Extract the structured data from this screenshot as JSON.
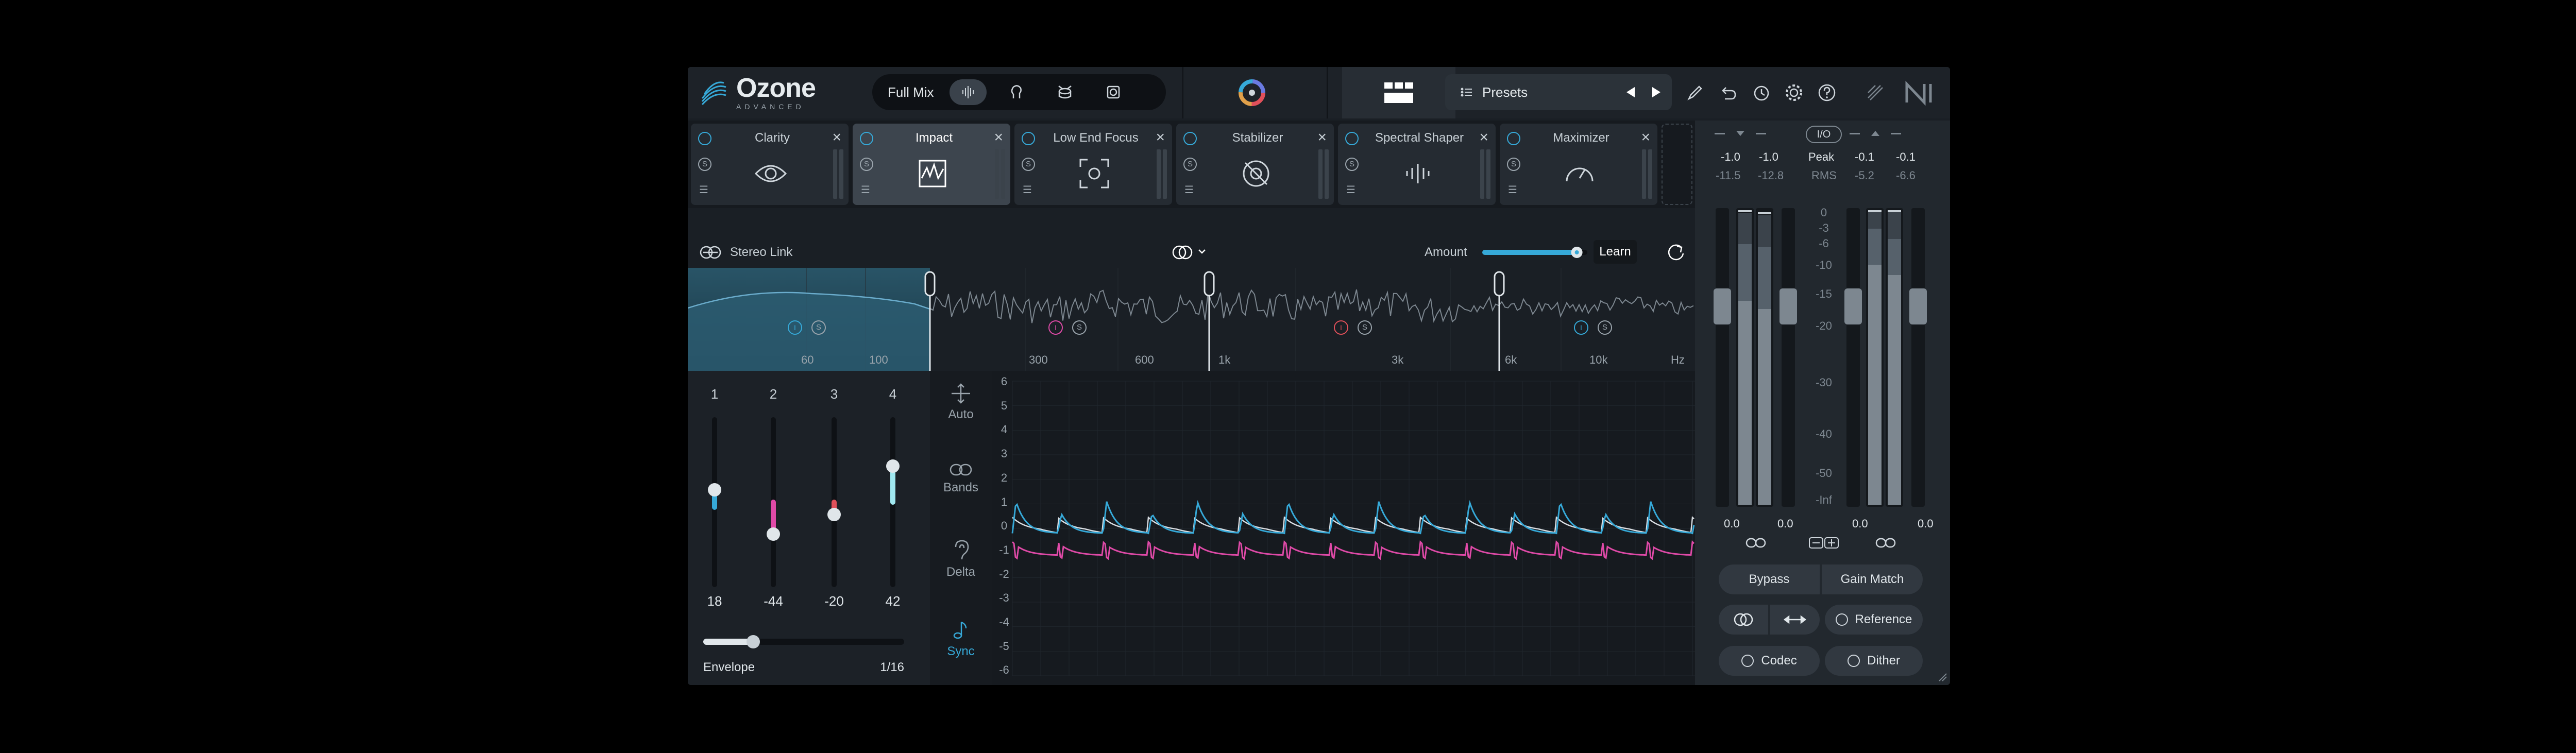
{
  "app": {
    "name": "Ozone",
    "edition": "ADVANCED"
  },
  "header": {
    "mix_label": "Full Mix",
    "presets_label": "Presets"
  },
  "modules": [
    {
      "name": "Clarity",
      "selected": false,
      "icon": "eye-icon"
    },
    {
      "name": "Impact",
      "selected": true,
      "icon": "impact-icon"
    },
    {
      "name": "Low End Focus",
      "selected": false,
      "icon": "focus-icon"
    },
    {
      "name": "Stabilizer",
      "selected": false,
      "icon": "stabilizer-icon"
    },
    {
      "name": "Spectral Shaper",
      "selected": false,
      "icon": "spectral-icon"
    },
    {
      "name": "Maximizer",
      "selected": false,
      "icon": "gauge-icon"
    }
  ],
  "module_controls": {
    "solo": "S"
  },
  "freq_controls": {
    "stereo_link": "Stereo Link",
    "amount": "Amount",
    "learn": "Learn",
    "amount_level": 0.9
  },
  "spectrum": {
    "freq_labels": [
      "60",
      "100",
      "300",
      "600",
      "1k",
      "3k",
      "6k",
      "10k",
      "Hz"
    ],
    "band_badges": [
      {
        "power": "I",
        "solo": "S",
        "power_color": "#36a9d8"
      },
      {
        "power": "I",
        "solo": "S",
        "power_color": "#e04aa8"
      },
      {
        "power": "I",
        "solo": "S",
        "power_color": "#e0505a"
      },
      {
        "power": "I",
        "solo": "S",
        "power_color": "#36a9d8"
      }
    ]
  },
  "bands": [
    {
      "num": "1",
      "value": "18",
      "color": "#36a9d8"
    },
    {
      "num": "2",
      "value": "-44",
      "color": "#e04aa8"
    },
    {
      "num": "3",
      "value": "-20",
      "color": "#e0505a"
    },
    {
      "num": "4",
      "value": "42",
      "color": "#a0e8f0"
    }
  ],
  "envelope": {
    "label": "Envelope",
    "value": "1/16"
  },
  "side_buttons": [
    {
      "label": "Auto",
      "active": false
    },
    {
      "label": "Bands",
      "active": false
    },
    {
      "label": "Delta",
      "active": false
    },
    {
      "label": "Sync",
      "active": true
    }
  ],
  "plot_y_labels": [
    "6",
    "5",
    "4",
    "3",
    "2",
    "1",
    "0",
    "-1",
    "-2",
    "-3",
    "-4",
    "-5",
    "-6"
  ],
  "meters": {
    "in_peak": [
      "-1.0",
      "-1.0"
    ],
    "in_rms": [
      "-11.5",
      "-12.8"
    ],
    "io_label": "I/O",
    "peak_label": "Peak",
    "rms_label": "RMS",
    "out_peak": [
      "-0.1",
      "-0.1"
    ],
    "out_rms": [
      "-5.2",
      "-6.6"
    ],
    "scale": [
      "0",
      "-3",
      "-6",
      "-10",
      "-15",
      "-20",
      "-30",
      "-40",
      "-50",
      "-Inf"
    ],
    "gain_values": [
      "0.0",
      "0.0",
      "0.0",
      "0.0"
    ]
  },
  "bottom_buttons": {
    "bypass": "Bypass",
    "gain_match": "Gain Match",
    "reference": "Reference",
    "codec": "Codec",
    "dither": "Dither"
  },
  "colors": {
    "accent": "#36a9d8",
    "pink": "#e04aa8",
    "red": "#e0505a"
  }
}
